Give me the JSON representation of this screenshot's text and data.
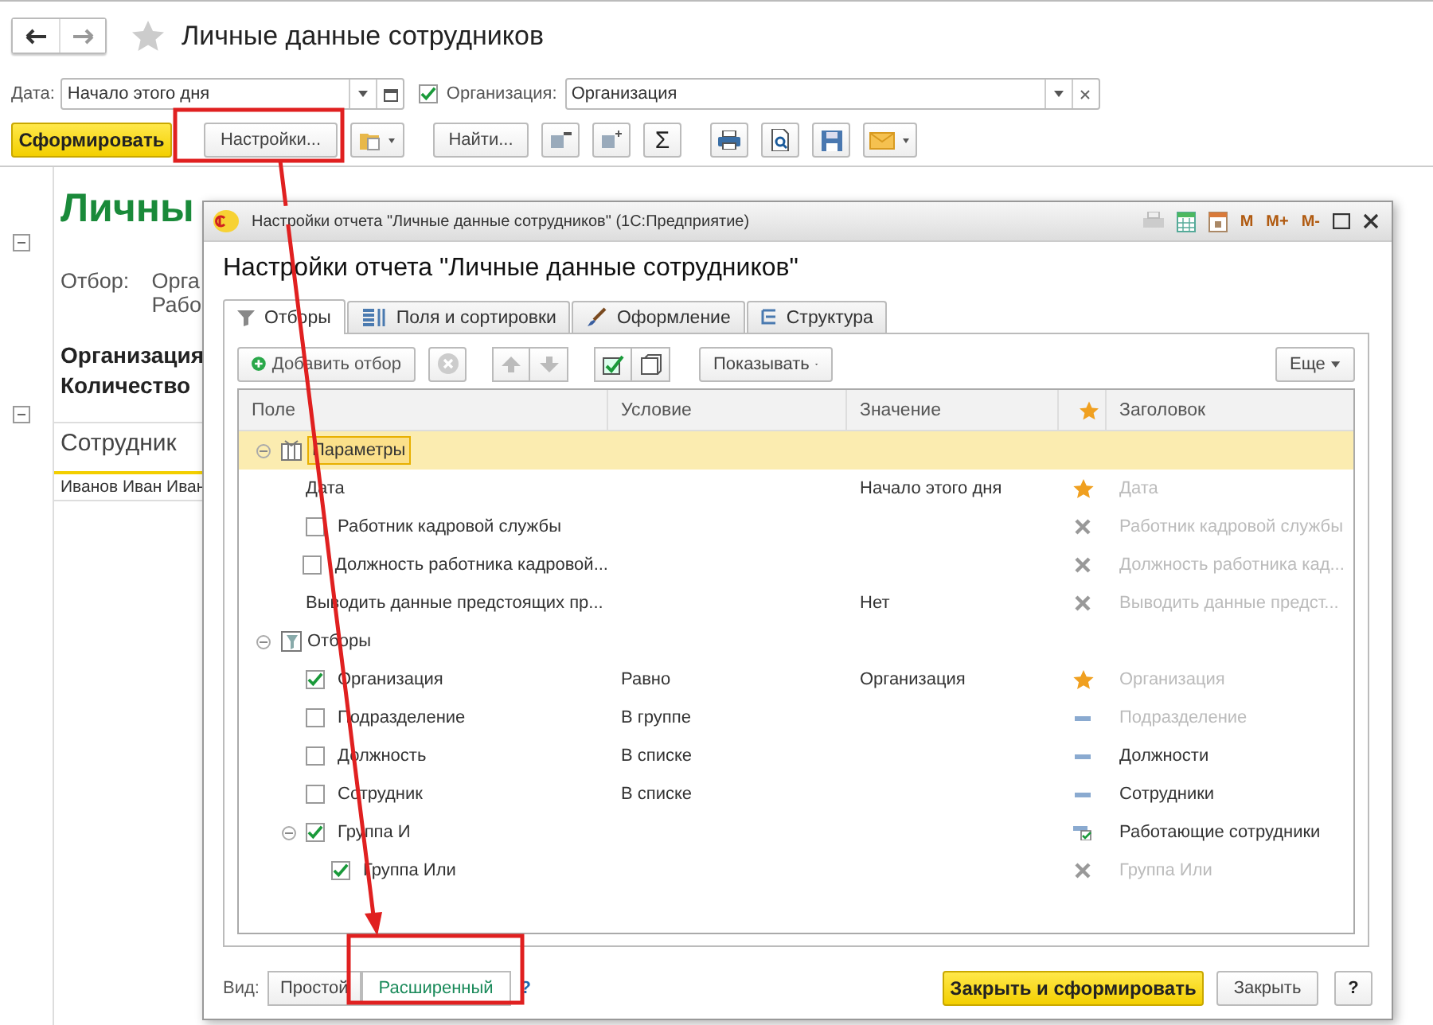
{
  "window": {
    "title": "Личные данные сотрудников"
  },
  "filters": {
    "date": {
      "label": "Дата:",
      "value": "Начало этого дня"
    },
    "organization": {
      "label": "Организация:",
      "checked": true,
      "value": "Организация"
    }
  },
  "toolbar": {
    "generate": "Сформировать",
    "settings": "Настройки...",
    "find": "Найти...",
    "sum": "Σ"
  },
  "report": {
    "title": "Личны",
    "filter_label": "Отбор:",
    "filter_lines": [
      "Орга",
      "Рабо"
    ],
    "group_lines": [
      "Организация",
      "Количество"
    ],
    "column_header": "Сотрудник",
    "row": "Иванов Иван Иван"
  },
  "dialog": {
    "window_title": "Настройки отчета \"Личные данные сотрудников\" (1С:Предприятие)",
    "memory_buttons": [
      "M",
      "M+",
      "M-"
    ],
    "heading": "Настройки отчета \"Личные данные сотрудников\"",
    "tabs": [
      {
        "label": "Отборы",
        "selected": true
      },
      {
        "label": "Поля и сортировки",
        "selected": false
      },
      {
        "label": "Оформление",
        "selected": false
      },
      {
        "label": "Структура",
        "selected": false
      }
    ],
    "panel_toolbar": {
      "add": "Добавить отбор",
      "show": "Показывать",
      "more": "Еще"
    },
    "columns": [
      "Поле",
      "Условие",
      "Значение",
      "Заголовок"
    ],
    "rows": [
      {
        "kind": "group",
        "field": "Параметры",
        "selected": true,
        "expanded": true,
        "children": [
          {
            "kind": "param",
            "field": "Дата",
            "value": "Начало этого дня",
            "use": {
              "kind": "star"
            },
            "title": "Дата",
            "title_default": true,
            "selected": false
          },
          {
            "kind": "filter",
            "checked": false,
            "field": "Работник кадровой службы",
            "use": {
              "kind": "off"
            },
            "title": "Работник кадровой службы",
            "title_default": true,
            "selected": false
          },
          {
            "kind": "filter",
            "checked": false,
            "field": "Должность работника кадровой...",
            "use": {
              "kind": "off"
            },
            "title": "Должность работника кад...",
            "title_default": true,
            "selected": false
          },
          {
            "kind": "param",
            "field": "Выводить данные предстоящих пр...",
            "value": "Нет",
            "use": {
              "kind": "off"
            },
            "title": "Выводить данные предст...",
            "title_default": true,
            "selected": false
          }
        ]
      },
      {
        "kind": "group",
        "field": "Отборы",
        "selected": false,
        "expanded": true,
        "children": [
          {
            "kind": "filter",
            "checked": true,
            "field": "Организация",
            "condition": "Равно",
            "value": "Организация",
            "use": {
              "kind": "star"
            },
            "title": "Организация",
            "title_default": true,
            "selected": false
          },
          {
            "kind": "filter",
            "checked": false,
            "field": "Подразделение",
            "condition": "В группе",
            "use": {
              "kind": "list"
            },
            "title": "Подразделение",
            "title_default": true,
            "selected": false
          },
          {
            "kind": "filter",
            "checked": false,
            "field": "Должность",
            "condition": "В списке",
            "use": {
              "kind": "list"
            },
            "title": "Должности",
            "title_default": false,
            "selected": false
          },
          {
            "kind": "filter",
            "checked": false,
            "field": "Сотрудник",
            "condition": "В списке",
            "use": {
              "kind": "list"
            },
            "title": "Сотрудники",
            "title_default": false,
            "selected": false
          },
          {
            "kind": "filter",
            "checked": true,
            "field": "Группа И",
            "use": {
              "kind": "group"
            },
            "title": "Работающие сотрудники",
            "title_default": false,
            "selected": false,
            "expanded": true,
            "children": [
              {
                "kind": "filter",
                "checked": true,
                "field": "Группа Или",
                "use": {
                  "kind": "off"
                },
                "title": "Группа Или",
                "title_default": true,
                "selected": false
              }
            ]
          }
        ]
      }
    ],
    "view_label": "Вид:",
    "view_modes": [
      {
        "label": "Простой",
        "selected": false
      },
      {
        "label": "Расширенный",
        "selected": true
      }
    ],
    "help_link": "?",
    "buttons": {
      "close_generate": "Закрыть и сформировать",
      "close": "Закрыть",
      "help": "?"
    }
  }
}
